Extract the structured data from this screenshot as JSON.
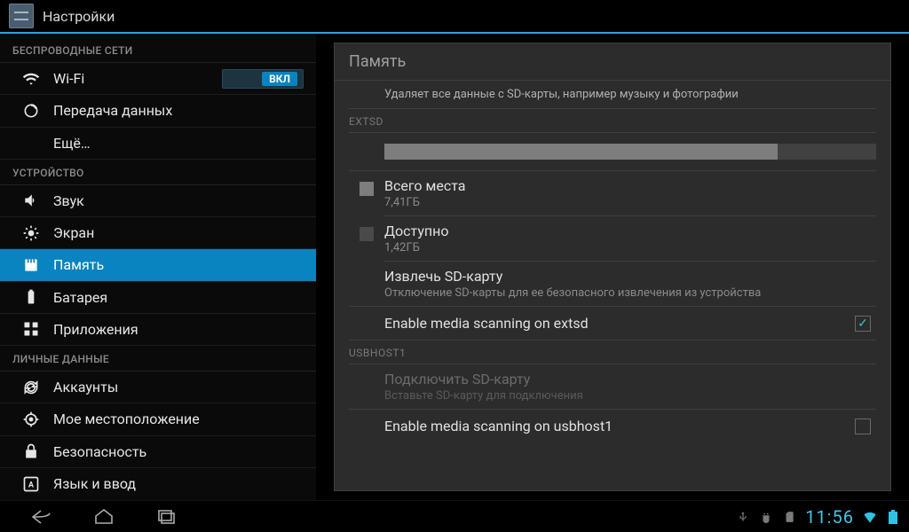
{
  "app": {
    "title": "Настройки"
  },
  "sidebar": {
    "sections": {
      "wireless": "БЕСПРОВОДНЫЕ СЕТИ",
      "device": "УСТРОЙСТВО",
      "personal": "ЛИЧНЫЕ ДАННЫЕ"
    },
    "items": {
      "wifi": "Wi-Fi",
      "wifi_toggle": "ВКЛ",
      "data": "Передача данных",
      "more": "Ещё…",
      "sound": "Звук",
      "display": "Экран",
      "storage": "Память",
      "battery": "Батарея",
      "apps": "Приложения",
      "accounts": "Аккаунты",
      "location": "Мое местоположение",
      "security": "Безопасность",
      "language": "Язык и ввод"
    }
  },
  "detail": {
    "title": "Память",
    "erase_desc": "Удаляет все данные с SD-карты, например музыку и фотографии",
    "extsd_header": "EXTSD",
    "usage_fill_percent": 80,
    "total_label": "Всего места",
    "total_value": "7,41ГБ",
    "avail_label": "Доступно",
    "avail_value": "1,42ГБ",
    "eject_label": "Извлечь SD-карту",
    "eject_desc": "Отключение SD-карты для ее безопасного извлечения из устройства",
    "scan_extsd": "Enable media scanning on extsd",
    "usbhost_header": "USBHOST1",
    "mount_label": "Подключить SD-карту",
    "mount_desc": "Вставьте SD-карту для подключения",
    "scan_usb": "Enable media scanning on usbhost1"
  },
  "status": {
    "time": "11:56"
  }
}
